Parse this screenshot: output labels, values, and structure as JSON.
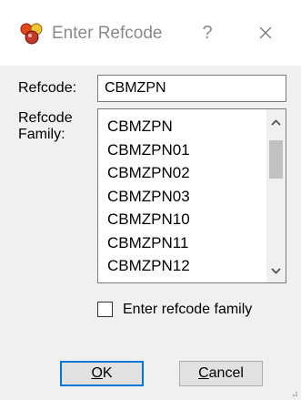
{
  "window": {
    "title": "Enter Refcode",
    "help_label": "?",
    "icons": {
      "app": "magnifier-cluster-icon",
      "close": "close-icon"
    }
  },
  "form": {
    "refcode_label": "Refcode:",
    "refcode_value": "CBMZPN",
    "family_label": "Refcode Family:",
    "family_items": [
      "CBMZPN",
      "CBMZPN01",
      "CBMZPN02",
      "CBMZPN03",
      "CBMZPN10",
      "CBMZPN11",
      "CBMZPN12"
    ],
    "checkbox_label": "Enter refcode family",
    "checkbox_checked": false
  },
  "buttons": {
    "ok_underlined": "O",
    "ok_rest": "K",
    "cancel_underlined": "C",
    "cancel_rest": "ancel"
  },
  "colors": {
    "accent": "#0078d7",
    "title_text": "#8a8a8a",
    "dialog_bg": "#f0f0f0"
  }
}
